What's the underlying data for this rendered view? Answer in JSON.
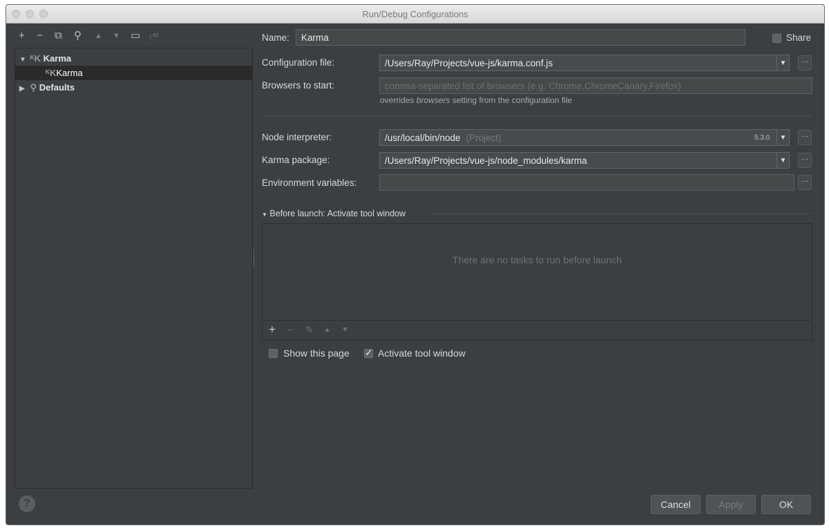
{
  "window": {
    "title": "Run/Debug Configurations"
  },
  "toolbar": {
    "add": "+",
    "remove": "−",
    "copy": "⧉",
    "edit_defaults": "⚲",
    "move_up": "▲",
    "move_down": "▼",
    "folder": "▭",
    "sort": "↓ᵃᶻ"
  },
  "tree": {
    "group_label": "Karma",
    "child_label": "Karma",
    "defaults_label": "Defaults"
  },
  "form": {
    "name_label": "Name:",
    "name_value": "Karma",
    "share_label": "Share",
    "config_file_label": "Configuration file:",
    "config_file_value": "/Users/Ray/Projects/vue-js/karma.conf.js",
    "browsers_label": "Browsers to start:",
    "browsers_placeholder": "comma-separated list of browsers (e.g. Chrome,ChromeCanary,Firefox)",
    "browsers_hint_prefix": "overrides",
    "browsers_hint_em": "browsers",
    "browsers_hint_suffix": "setting from the configuration file",
    "node_label": "Node interpreter:",
    "node_value": "/usr/local/bin/node",
    "node_project": "(Project)",
    "node_version": "5.3.0",
    "karma_pkg_label": "Karma package:",
    "karma_pkg_value": "/Users/Ray/Projects/vue-js/node_modules/karma",
    "env_label": "Environment variables:",
    "env_value": ""
  },
  "before_launch": {
    "title": "Before launch: Activate tool window",
    "empty_text": "There are no tasks to run before launch",
    "show_page_label": "Show this page",
    "show_page_checked": false,
    "activate_label": "Activate tool window",
    "activate_checked": true
  },
  "buttons": {
    "cancel": "Cancel",
    "apply": "Apply",
    "ok": "OK",
    "help": "?"
  },
  "colors": {
    "panel": "#3c3f41",
    "field": "#45494a",
    "selection": "#2a2a2a"
  }
}
